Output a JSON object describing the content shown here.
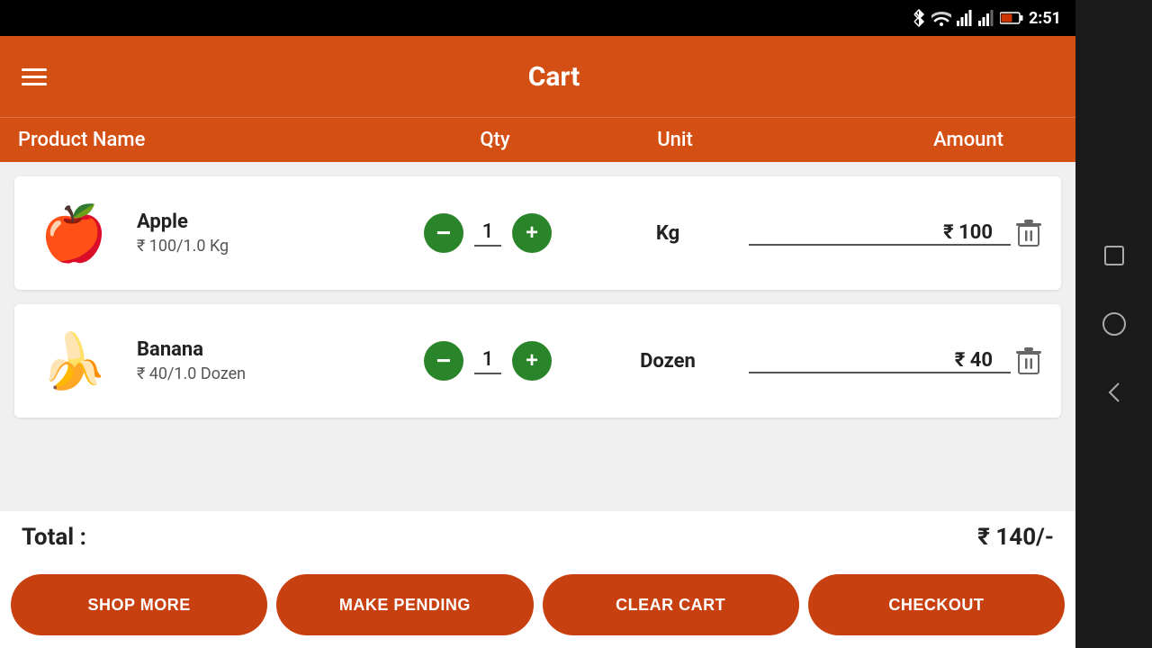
{
  "statusBar": {
    "time": "2:51",
    "icons": [
      "bluetooth",
      "wifi",
      "signal1",
      "signal2",
      "battery"
    ]
  },
  "header": {
    "title": "Cart",
    "menuIcon": "menu-icon"
  },
  "tableHeader": {
    "productName": "Product Name",
    "qty": "Qty",
    "unit": "Unit",
    "amount": "Amount"
  },
  "items": [
    {
      "id": "apple",
      "name": "Apple",
      "priceInfo": "₹ 100/1.0 Kg",
      "qty": 1,
      "unit": "Kg",
      "amount": "₹ 100",
      "emoji": "🍎"
    },
    {
      "id": "banana",
      "name": "Banana",
      "priceInfo": "₹ 40/1.0 Dozen",
      "qty": 1,
      "unit": "Dozen",
      "amount": "₹ 40",
      "emoji": "🍌"
    }
  ],
  "total": {
    "label": "Total :",
    "amount": "₹ 140/-"
  },
  "buttons": {
    "shopMore": "SHOP MORE",
    "makePending": "MAKE PENDING",
    "clearCart": "CLEAR CART",
    "checkout": "CHECKOUT"
  },
  "androidNav": {
    "square": "□",
    "circle": "○",
    "triangle": "◁"
  }
}
